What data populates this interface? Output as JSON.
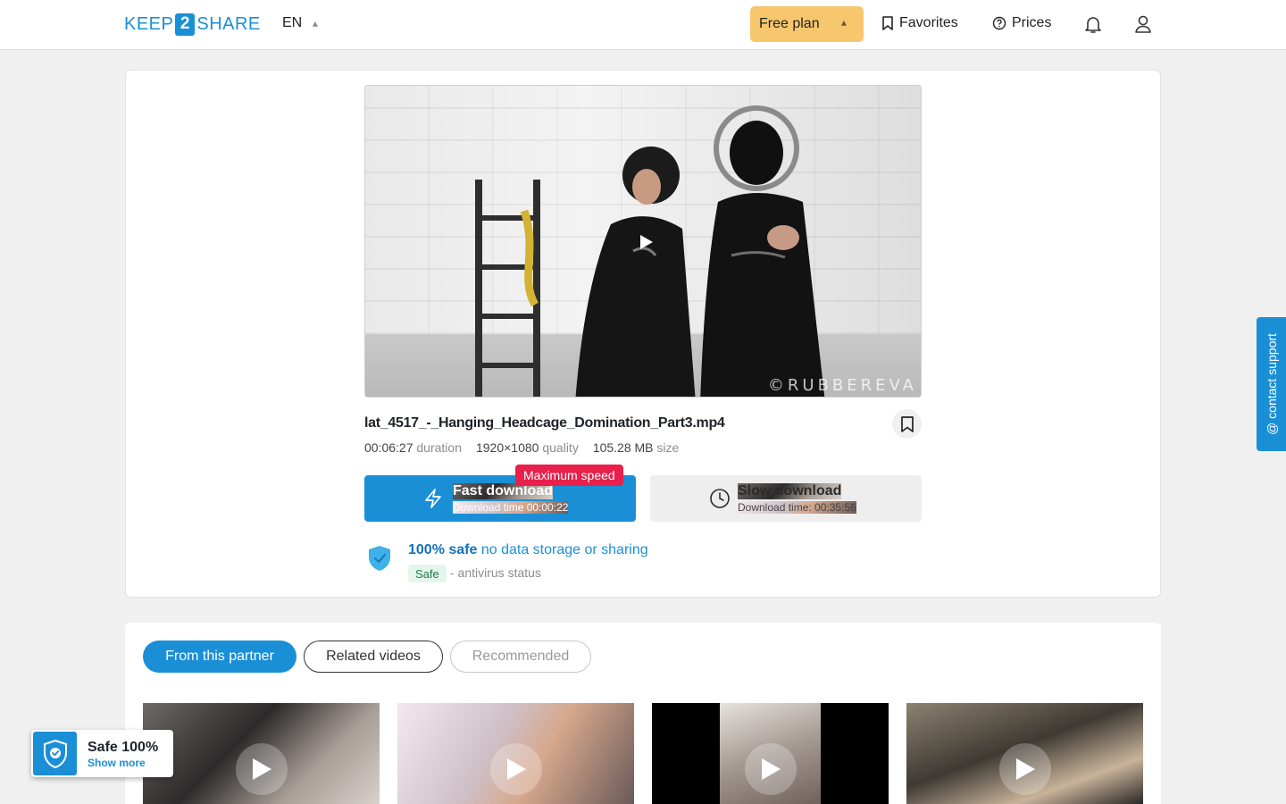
{
  "header": {
    "logo_left": "KEEP",
    "logo_mid": "2",
    "logo_right": "SHARE",
    "language": "EN",
    "plan_label": "Free plan",
    "favorites_label": "Favorites",
    "prices_label": "Prices"
  },
  "file": {
    "name": "lat_4517_-_Hanging_Headcage_Domination_Part3.mp4",
    "duration_value": "00:06:27",
    "duration_label": "duration",
    "quality_value": "1920×1080",
    "quality_label": "quality",
    "size_value": "105.28 MB",
    "size_label": "size",
    "watermark": "©RUBBEREVA"
  },
  "download": {
    "fast_title": "Fast download",
    "fast_sub": "Download time 00:00:22",
    "max_speed_badge": "Maximum speed",
    "slow_title": "Slow download",
    "slow_sub": "Download time: 00:35:56"
  },
  "safety": {
    "safe_bold": "100% safe",
    "safe_rest": " no data storage or sharing",
    "badge": "Safe",
    "antivirus": "- antivirus status"
  },
  "support_label": "@ contact support",
  "tabs": [
    {
      "label": "From this partner"
    },
    {
      "label": "Related videos"
    },
    {
      "label": "Recommended"
    }
  ],
  "widget": {
    "title": "Safe 100%",
    "link": "Show more"
  },
  "colors": {
    "accent": "#1a8fd6",
    "plan_bg": "#f7c76d",
    "max_speed": "#e8204b",
    "safe_badge_bg": "#e4f6ec"
  },
  "icons": {
    "fast": "lightning-icon",
    "slow": "clock-icon",
    "bookmark": "bookmark-icon",
    "bell": "bell-icon",
    "user": "user-icon",
    "shield": "shield-check-icon",
    "play": "play-icon"
  }
}
